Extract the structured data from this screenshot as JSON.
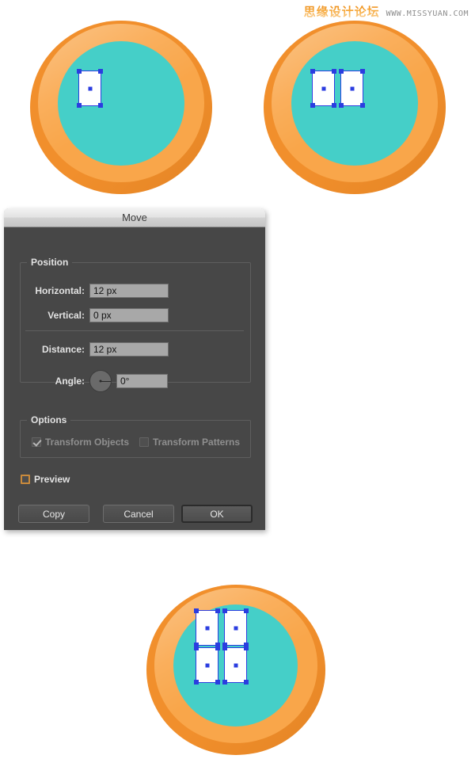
{
  "watermark": {
    "cn_text": "思缘设计论坛",
    "en_text": "WWW.MISSYUAN.COM"
  },
  "dialog": {
    "title": "Move",
    "position_group": {
      "label": "Position",
      "horizontal_label": "Horizontal:",
      "horizontal_value": "12 px",
      "vertical_label": "Vertical:",
      "vertical_value": "0 px",
      "distance_label": "Distance:",
      "distance_value": "12 px",
      "angle_label": "Angle:",
      "angle_value": "0°"
    },
    "options_group": {
      "label": "Options",
      "transform_objects_label": "Transform Objects",
      "transform_objects_checked": true,
      "transform_patterns_label": "Transform Patterns",
      "transform_patterns_checked": false
    },
    "preview_label": "Preview",
    "preview_checked": false,
    "buttons": {
      "copy": "Copy",
      "cancel": "Cancel",
      "ok": "OK"
    }
  },
  "artwork": {
    "colors": {
      "ring_outer": "#f18f2c",
      "ring_inner_light": "#f9a64a",
      "disc_teal": "#45cfc8",
      "selection_blue": "#2b3de0",
      "rect_fill": "#ffffff"
    },
    "icons": [
      {
        "name": "icon-one-rect",
        "rect_count": 1
      },
      {
        "name": "icon-two-rects",
        "rect_count": 2
      },
      {
        "name": "icon-four-rects",
        "rect_count": 4
      }
    ]
  }
}
